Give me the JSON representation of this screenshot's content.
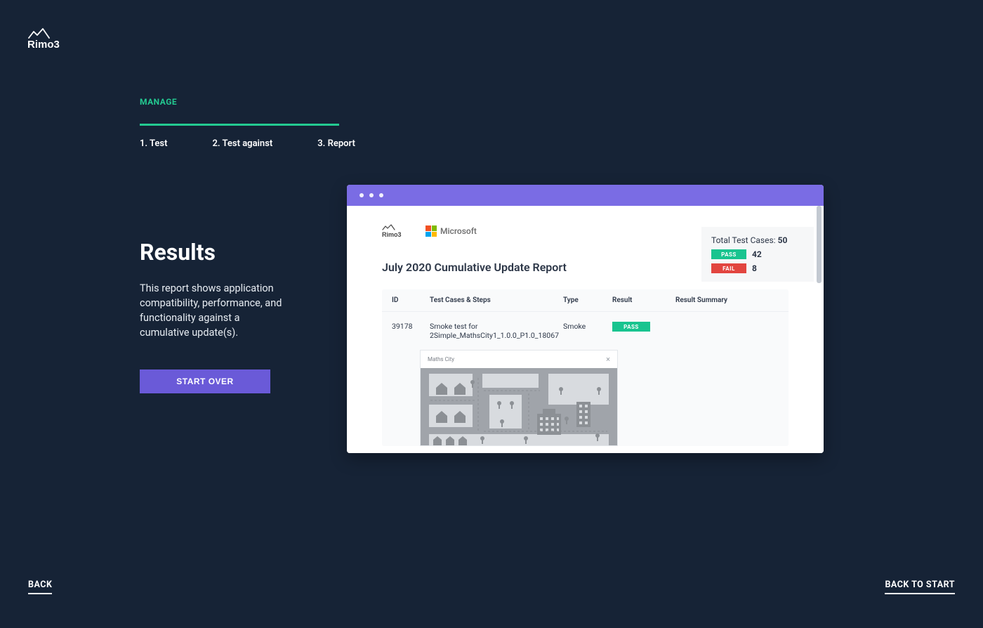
{
  "brand": "Rimo3",
  "tab": "MANAGE",
  "steps": [
    "1. Test",
    "2. Test against",
    "3. Report"
  ],
  "headline": "Results",
  "description": "This report shows application compatibility, performance, and functionality against a cumulative update(s).",
  "start_over": "START OVER",
  "nav": {
    "back": "BACK",
    "back_to_start": "BACK TO START"
  },
  "report": {
    "partner": "Microsoft",
    "title": "July 2020 Cumulative Update Report",
    "summary": {
      "label": "Total Test Cases:",
      "total": "50",
      "pass_label": "PASS",
      "pass_count": "42",
      "fail_label": "FAIL",
      "fail_count": "8"
    },
    "columns": [
      "ID",
      "Test Cases & Steps",
      "Type",
      "Result",
      "Result Summary"
    ],
    "row": {
      "id": "39178",
      "name": "Smoke test for 2Simple_MathsCity1_1.0.0_P1.0_18067",
      "type": "Smoke",
      "result": "PASS"
    },
    "thumb": {
      "title": "Maths City"
    }
  }
}
